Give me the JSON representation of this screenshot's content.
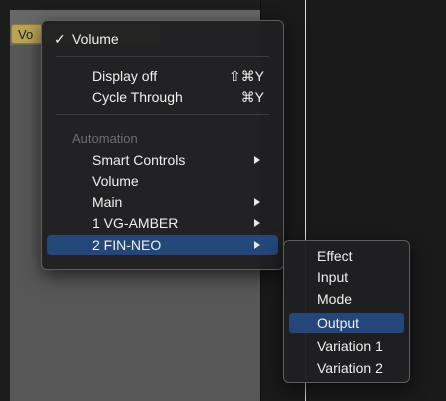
{
  "header": {
    "automation_selector_label": "Vo"
  },
  "main_menu": {
    "checked_item": {
      "check": "✓",
      "label": "Volume"
    },
    "display_off": {
      "label": "Display off",
      "shortcut": "⇧⌘Y"
    },
    "cycle_through": {
      "label": "Cycle Through",
      "shortcut": "⌘Y"
    },
    "automation_header": "Automation",
    "automation_items": [
      {
        "label": "Smart Controls",
        "submenu": true
      },
      {
        "label": "Volume",
        "submenu": false
      },
      {
        "label": "Main",
        "submenu": true
      },
      {
        "label": "1 VG-AMBER",
        "submenu": true
      },
      {
        "label": "2 FIN-NEO",
        "submenu": true,
        "highlighted": true
      }
    ]
  },
  "sub_menu": {
    "items": [
      {
        "label": "Effect"
      },
      {
        "label": "Input"
      },
      {
        "label": "Mode"
      },
      {
        "label": "Output",
        "highlighted": true
      },
      {
        "label": "Variation 1"
      },
      {
        "label": "Variation 2"
      }
    ]
  },
  "colors": {
    "highlight": "#24477a",
    "selector_accent": "#b9a455",
    "menu_bg": "#202022"
  }
}
